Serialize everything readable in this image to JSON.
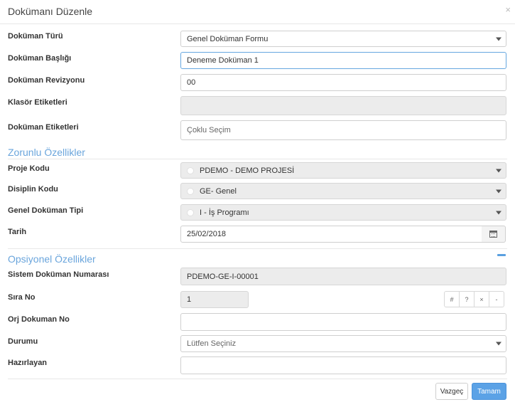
{
  "dialog": {
    "title": "Dokümanı Düzenle",
    "close_glyph": "×"
  },
  "fields": {
    "doc_type": {
      "label": "Doküman Türü",
      "value": "Genel Doküman Formu"
    },
    "doc_title": {
      "label": "Doküman Başlığı",
      "value": "Deneme Doküman 1"
    },
    "doc_revision": {
      "label": "Doküman Revizyonu",
      "value": "00"
    },
    "folder_tags": {
      "label": "Klasör Etiketleri",
      "value": ""
    },
    "doc_tags": {
      "label": "Doküman Etiketleri",
      "placeholder": "Çoklu Seçim"
    }
  },
  "required": {
    "heading": "Zorunlu Özellikler",
    "project_code": {
      "label": "Proje Kodu",
      "value": "PDEMO - DEMO PROJESİ"
    },
    "discipline_code": {
      "label": "Disiplin Kodu",
      "value": "GE- Genel"
    },
    "general_doc_type": {
      "label": "Genel Doküman Tipi",
      "value": "I - İş Programı"
    },
    "date": {
      "label": "Tarih",
      "value": "25/02/2018"
    }
  },
  "optional": {
    "heading": "Opsiyonel Özellikler",
    "system_doc_no": {
      "label": "Sistem Doküman Numarası",
      "value": "PDEMO-GE-I-00001"
    },
    "sequence_no": {
      "label": "Sıra No",
      "value": "1"
    },
    "seq_buttons": [
      "#",
      "?",
      "×",
      "-"
    ],
    "orig_doc_no": {
      "label": "Orj Dokuman No",
      "value": ""
    },
    "status": {
      "label": "Durumu",
      "placeholder": "Lütfen Seçiniz"
    },
    "prepared_by": {
      "label": "Hazırlayan",
      "value": ""
    }
  },
  "footer": {
    "cancel_label": "Vazgeç",
    "ok_label": "Tamam"
  },
  "colors": {
    "accent": "#5ba2e6",
    "section_heading": "#6aa5dc",
    "readonly_bg": "#ececec"
  }
}
